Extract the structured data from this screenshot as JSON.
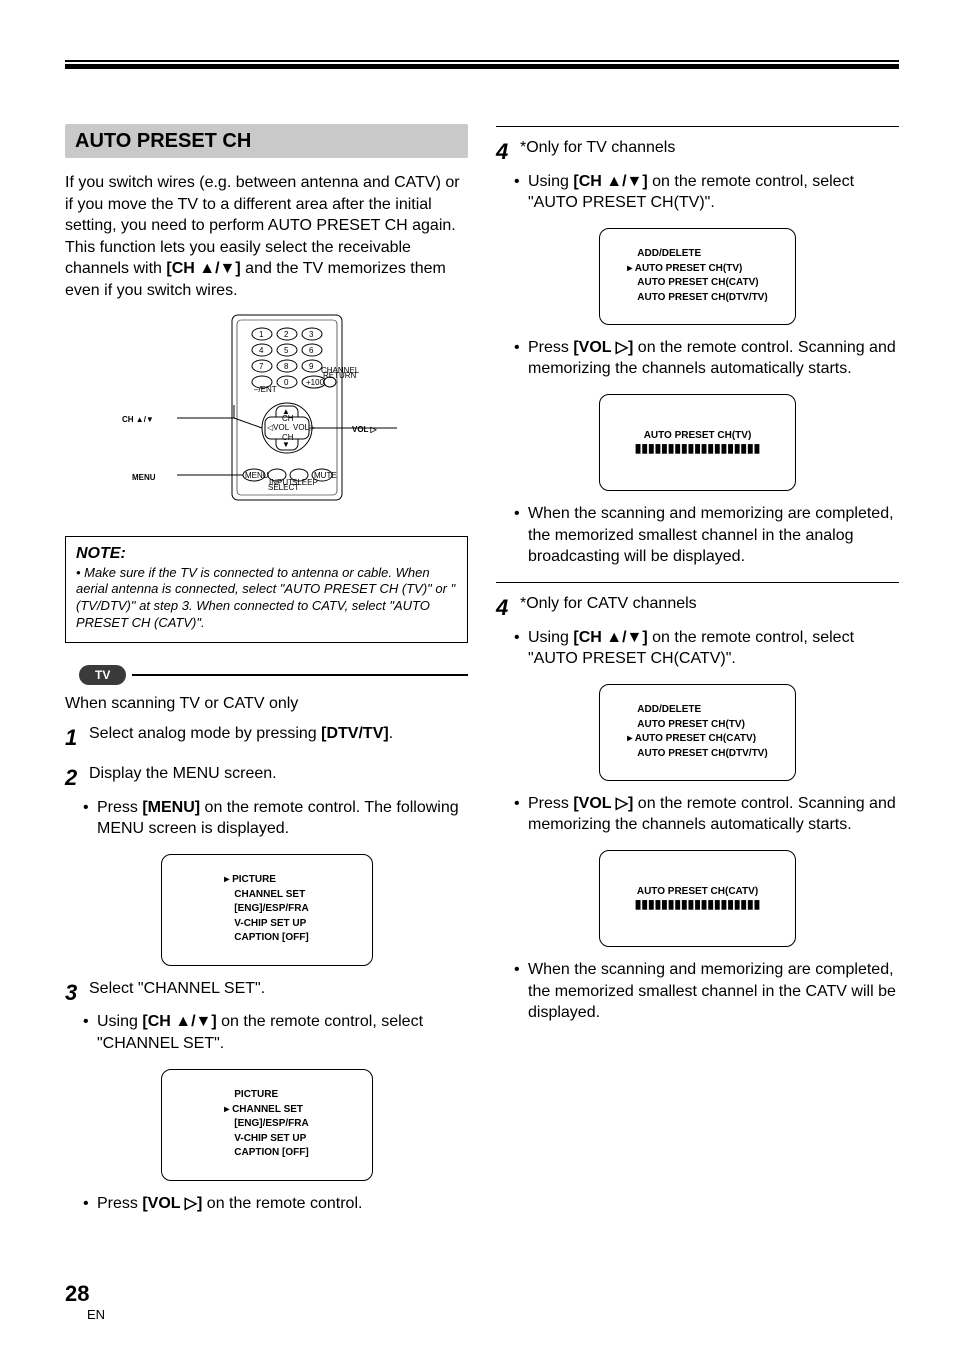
{
  "hrule": "",
  "section_title": "AUTO PRESET CH",
  "intro_parts": {
    "p1": "If you switch wires (e.g. between antenna and CATV) or if you move the TV to a different area after the initial setting, you need to perform AUTO PRESET CH again. This function lets you easily select the receivable channels with ",
    "p2": " and the TV memorizes them even if you switch wires."
  },
  "key_ch": "[CH ▲/▼]",
  "key_vol_up": "[VOL ▷]",
  "key_menu": "[MENU]",
  "key_dtv": "[DTV/TV]",
  "remote_labels": {
    "ch": "CH ▲/▼",
    "vol": "VOL ▷",
    "menu": "MENU"
  },
  "note": {
    "title": "NOTE:",
    "body": "• Make sure if the TV is connected to antenna or cable. When aerial antenna is connected, select \"AUTO PRESET CH (TV)\" or \"(TV/DTV)\" at step 3.  When connected to CATV, select \"AUTO PRESET CH (CATV)\"."
  },
  "tv_pill": "TV",
  "tv_subhead": "When scanning TV or CATV only",
  "steps": {
    "s1": {
      "text_a": "Select analog mode by pressing ",
      "text_b": "."
    },
    "s2": {
      "text": "Display the MENU screen."
    },
    "s2b": {
      "a": "Press ",
      "b": " on the remote control. The following MENU screen is displayed."
    },
    "s3": {
      "text": "Select \"CHANNEL SET\"."
    },
    "s3b": {
      "a": "Using ",
      "b": " on the remote control, select \"CHANNEL SET\"."
    },
    "s3c": {
      "a": "Press ",
      "b": " on the remote control."
    },
    "s4tv_head": "*Only for TV channels",
    "s4tvb": {
      "a": "Using ",
      "b": " on the remote control, select \"AUTO PRESET CH(TV)\"."
    },
    "s4tvc": {
      "a": "Press ",
      "b": " on the remote control. Scanning and memorizing the channels automatically starts."
    },
    "s4tvd": "When the scanning and memorizing are completed, the memorized smallest channel in the analog broadcasting will be displayed.",
    "s4catv_head": "*Only for CATV channels",
    "s4catvb": {
      "a": "Using ",
      "b": " on the remote control, select \"AUTO PRESET CH(CATV)\"."
    },
    "s4catvc": {
      "a": "Press ",
      "b": " on the remote control. Scanning and memorizing the channels automatically starts."
    },
    "s4catvd": "When the scanning and memorizing are completed, the memorized smallest channel in the CATV will be displayed."
  },
  "osd_menu": {
    "items": [
      "PICTURE",
      "CHANNEL SET",
      "[ENG]/ESP/FRA",
      "V-CHIP SET UP",
      "CAPTION [OFF]"
    ],
    "sel_picture": 0,
    "sel_channel": 1
  },
  "osd_ch": {
    "items": [
      "ADD/DELETE",
      "AUTO PRESET CH(TV)",
      "AUTO PRESET CH(CATV)",
      "AUTO PRESET CH(DTV/TV)"
    ],
    "sel_tv": 1,
    "sel_catv": 2
  },
  "progress_tv": "AUTO PRESET CH(TV)",
  "progress_catv": "AUTO PRESET CH(CATV)",
  "progress_bar": "▮▮▮▮▮▮▮▮▮▮▮▮▮▮▮▮▮▮▮",
  "page_number": "28",
  "page_lang": "EN"
}
